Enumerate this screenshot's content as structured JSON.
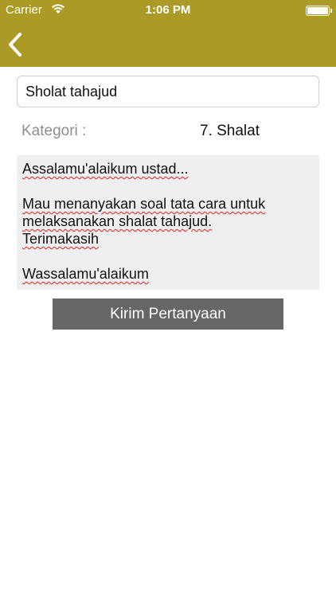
{
  "status_bar": {
    "carrier": "Carrier",
    "time": "1:06 PM",
    "wifi_icon": "wifi-icon",
    "battery_icon": "battery-icon"
  },
  "nav": {
    "back_icon": "chevron-left-icon",
    "bar_color": "#ac9a26"
  },
  "form": {
    "title_value": "Sholat tahajud",
    "category_label": "Kategori :",
    "category_value": "7. Shalat",
    "message_lines": {
      "l1": "Assalamu'alaikum ustad...",
      "l2": "Mau menanyakan soal tata cara untuk",
      "l3": "melaksanakan shalat tahajud.",
      "l4": "Terimakasih",
      "l5": "Wassalamu'alaikum"
    },
    "submit_label": "Kirim Pertanyaan"
  }
}
